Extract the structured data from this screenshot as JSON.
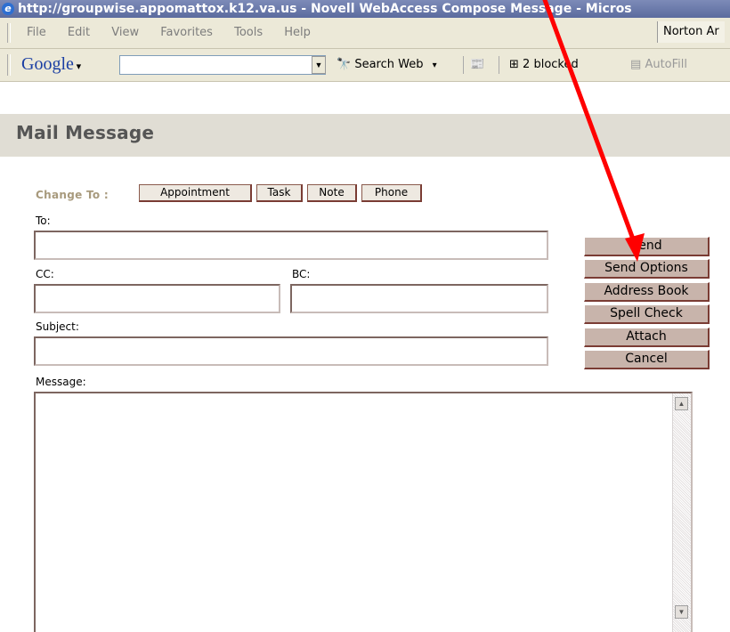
{
  "window": {
    "title": "http://groupwise.appomattox.k12.va.us - Novell WebAccess Compose Message - Micros"
  },
  "menubar": {
    "items": [
      "File",
      "Edit",
      "View",
      "Favorites",
      "Tools",
      "Help"
    ],
    "norton": "Norton Ar"
  },
  "google_toolbar": {
    "logo": "Google",
    "search_web": "Search Web",
    "blocked": "2 blocked",
    "autofill": "AutoFill"
  },
  "page": {
    "title": "Mail Message"
  },
  "change_to": {
    "label": "Change To :",
    "buttons": [
      "Appointment",
      "Task",
      "Note",
      "Phone"
    ]
  },
  "fields": {
    "to": "To:",
    "cc": "CC:",
    "bc": "BC:",
    "subject": "Subject:",
    "message": "Message:"
  },
  "actions": [
    "Send",
    "Send Options",
    "Address Book",
    "Spell Check",
    "Attach",
    "Cancel"
  ],
  "colors": {
    "annotation_arrow": "#ff0000",
    "action_button": "#c8b4ab"
  }
}
